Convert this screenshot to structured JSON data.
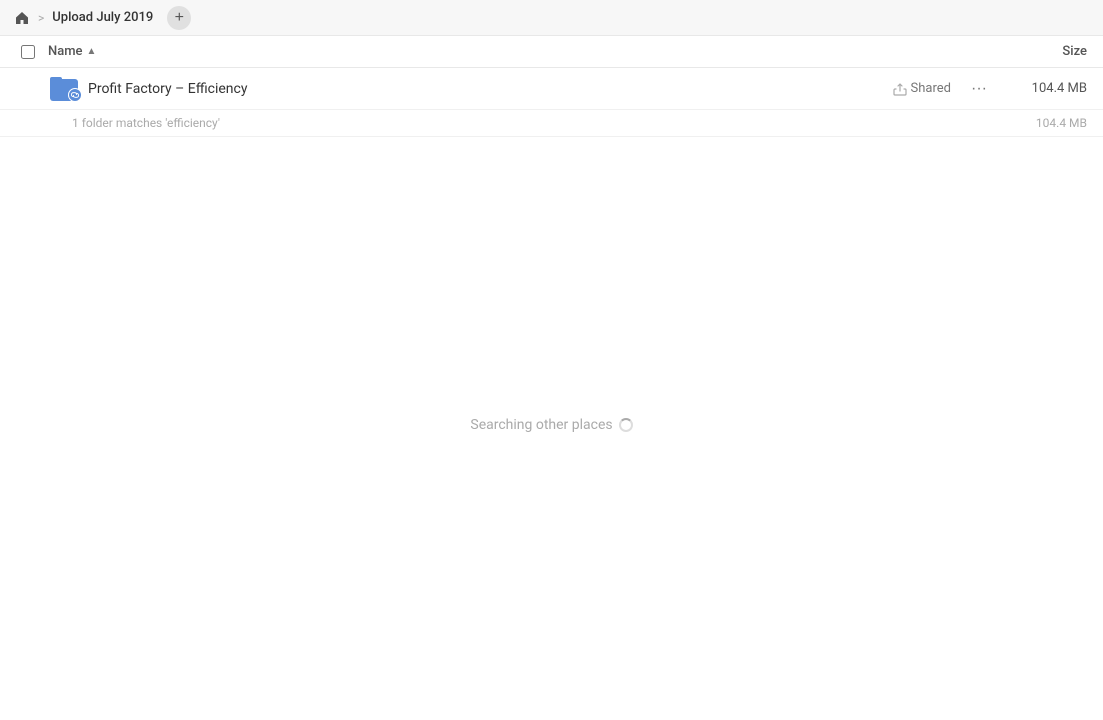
{
  "header": {
    "home_icon": "home",
    "breadcrumb_separator": ">",
    "title": "Upload July 2019",
    "new_tab_label": "+"
  },
  "columns": {
    "name_label": "Name",
    "size_label": "Size",
    "sort_indicator": "▲"
  },
  "files": [
    {
      "name": "Profit Factory – Efficiency",
      "shared_label": "Shared",
      "size": "104.4 MB",
      "has_link": true
    }
  ],
  "match_info": {
    "text": "1 folder matches 'efficiency'",
    "size": "104.4 MB"
  },
  "search_status": {
    "text": "Searching other places"
  }
}
